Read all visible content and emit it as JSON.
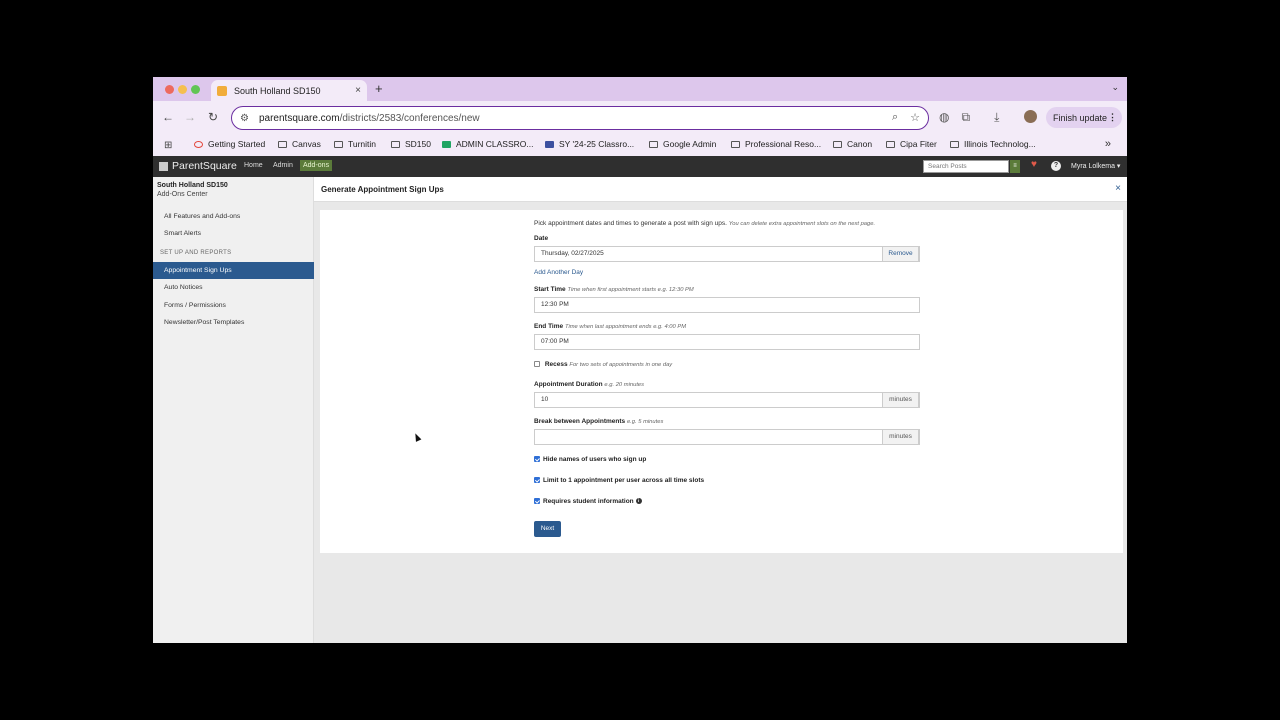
{
  "browser": {
    "tab_title": "South Holland SD150",
    "tab_close": "×",
    "new_tab": "+",
    "tab_menu": "⌄",
    "url_host": "parentsquare.com",
    "url_path": "/districts/2583/conferences/new",
    "finish_update": "Finish update",
    "bookmarks": [
      "Getting Started",
      "Canvas",
      "Turnitin",
      "SD150",
      "ADMIN CLASSRO...",
      "SY '24-25 Classro...",
      "Google Admin",
      "Professional Reso...",
      "Canon",
      "Cipa Fiter",
      "Illinois Technolog..."
    ],
    "bookmarks_more": "»"
  },
  "appnav": {
    "logo": "ParentSquare",
    "links": [
      "Home",
      "Admin",
      "Add-ons"
    ],
    "search_placeholder": "Search Posts",
    "user": "Myra Lolkema ▾"
  },
  "sidebar": {
    "org": "South Holland SD150",
    "subtitle": "Add-Ons Center",
    "items_top": [
      "All Features and Add-ons",
      "Smart Alerts"
    ],
    "section_header": "SET UP AND REPORTS",
    "items": [
      "Appointment Sign Ups",
      "Auto Notices",
      "Forms / Permissions",
      "Newsletter/Post Templates"
    ],
    "active_item": "Appointment Sign Ups"
  },
  "main": {
    "title": "Generate Appointment Sign Ups",
    "close": "×",
    "intro": "Pick appointment dates and times to generate a post with sign ups.",
    "intro_hint": "You can delete extra appointment slots on the next page.",
    "date_label": "Date",
    "date_value": "Thursday, 02/27/2025",
    "remove": "Remove",
    "add_day": "Add Another Day",
    "start_label": "Start Time",
    "start_hint": "Time when first appointment starts e.g. 12:30 PM",
    "start_value": "12:30 PM",
    "end_label": "End Time",
    "end_hint": "Time when last appointment ends e.g. 4:00 PM",
    "end_value": "07:00 PM",
    "recess_label": "Recess",
    "recess_hint": "For two sets of appointments in one day",
    "duration_label": "Appointment Duration",
    "duration_hint": "e.g. 20 minutes",
    "duration_value": "10",
    "minutes": "minutes",
    "break_label": "Break between Appointments",
    "break_hint": "e.g. 5 minutes",
    "break_value": "",
    "hide_names": "Hide names of users who sign up",
    "limit_one": "Limit to 1 appointment per user across all time slots",
    "requires_student": "Requires student information",
    "next": "Next"
  },
  "icons": {
    "back": "arrow-left-icon",
    "forward": "arrow-right-icon",
    "reload": "reload-icon",
    "info": "info-icon"
  }
}
